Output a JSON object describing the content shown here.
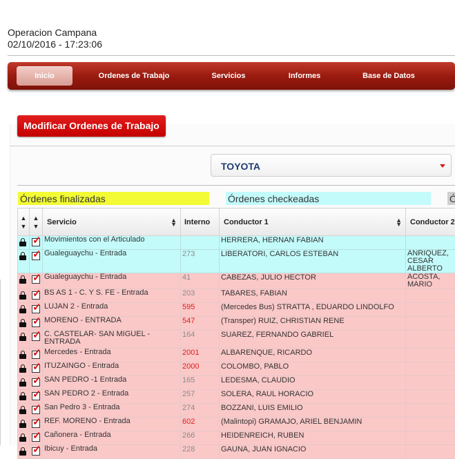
{
  "header": {
    "title": "Operacion Campana",
    "datetime": "02/10/2016 - 17:23:06"
  },
  "nav": {
    "items": [
      "Inicio",
      "Ordenes de Trabajo",
      "Servicios",
      "Informes",
      "Base de Datos"
    ]
  },
  "page": {
    "title_button": "Modificar Ordenes de Trabajo"
  },
  "filter": {
    "selected": "TOYOTA"
  },
  "legend": {
    "finalizadas": "Órdenes finalizadas",
    "checkeadas": "Órdenes checkeadas",
    "third": "Ó"
  },
  "table": {
    "headers": [
      "Servicio",
      "Interno",
      "Conductor 1",
      "Conductor 2"
    ],
    "rows": [
      {
        "servicio": "Movimientos con el Articulado",
        "interno": "",
        "conductor1": "HERRERA, HERNAN FABIAN",
        "conductor2": ""
      },
      {
        "servicio": "Gualeguaychu - Entrada",
        "interno": "273",
        "conductor1": "LIBERATORI, CARLOS ESTEBAN",
        "conductor2": "ANRIQUEZ, CESAR ALBERTO"
      },
      {
        "servicio": "Gualeguaychu - Entrada",
        "interno": "41",
        "conductor1": "CABEZAS, JULIO HECTOR",
        "conductor2": "ACOSTA, MARIO"
      },
      {
        "servicio": "BS AS 1 - C. Y S. FE - Entrada",
        "interno": "203",
        "conductor1": "TABARES, FABIAN",
        "conductor2": ""
      },
      {
        "servicio": "LUJAN 2 - Entrada",
        "interno": "595",
        "conductor1": "(Mercedes Bus) STRATTA , EDUARDO LINDOLFO",
        "conductor2": ""
      },
      {
        "servicio": "MORENO - ENTRADA",
        "interno": "547",
        "conductor1": "(Transper) RUIZ, CHRISTIAN RENE",
        "conductor2": ""
      },
      {
        "servicio": "C. CASTELAR- SAN MIGUEL - ENTRADA",
        "interno": "164",
        "conductor1": "SUAREZ, FERNANDO GABRIEL",
        "conductor2": ""
      },
      {
        "servicio": "Mercedes - Entrada",
        "interno": "2001",
        "conductor1": "ALBARENQUE, RICARDO",
        "conductor2": ""
      },
      {
        "servicio": "ITUZAINGO - Entrada",
        "interno": "2000",
        "conductor1": "COLOMBO, PABLO",
        "conductor2": ""
      },
      {
        "servicio": "SAN PEDRO -1 Entrada",
        "interno": "165",
        "conductor1": "LEDESMA, CLAUDIO",
        "conductor2": ""
      },
      {
        "servicio": "SAN PEDRO 2 - Entrada",
        "interno": "257",
        "conductor1": "SOLERA, RAUL HORACIO",
        "conductor2": ""
      },
      {
        "servicio": "San Pedro 3 - Entrada",
        "interno": "274",
        "conductor1": "BOZZANI, LUIS EMILIO",
        "conductor2": ""
      },
      {
        "servicio": "REF. MORENO - Entrada",
        "interno": "602",
        "conductor1": "(Malintopi) GRAMAJO, ARIEL BENJAMIN",
        "conductor2": ""
      },
      {
        "servicio": "Cañonera - Entrada",
        "interno": "266",
        "conductor1": "HEIDENREICH, RUBEN",
        "conductor2": ""
      },
      {
        "servicio": "Ibicuy - Entrada",
        "interno": "228",
        "conductor1": "GAUNA, JUAN IGNACIO",
        "conductor2": ""
      }
    ]
  },
  "colors": {
    "finalizada": "#f2fb33",
    "checkeada": "#c3fbfb",
    "pendiente": "#fbc8c8",
    "red_number": "#e01b1b"
  }
}
